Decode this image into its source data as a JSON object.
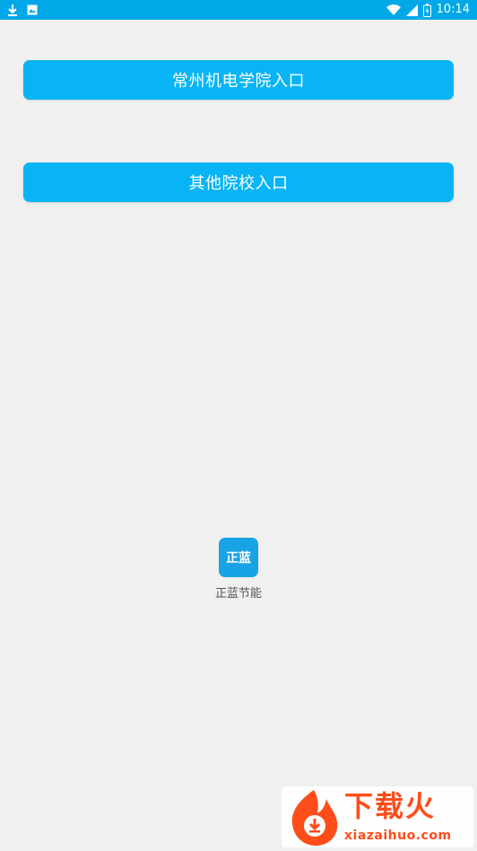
{
  "status_bar": {
    "time": "10:14",
    "left_icons": [
      "download-icon",
      "photo-icon"
    ],
    "right_icons": [
      "wifi-icon",
      "signal-icon",
      "battery-icon"
    ],
    "color": "#00a8e8"
  },
  "buttons": {
    "primary_label": "常州机电学院入口",
    "secondary_label": "其他院校入口",
    "color": "#08b4f5"
  },
  "app": {
    "logo_text": "正蓝",
    "name": "正蓝节能",
    "logo_color": "#18a4e4"
  },
  "watermark": {
    "title": "下载火",
    "url": "xiazaihuo.com",
    "color": "#ff4d1a"
  }
}
